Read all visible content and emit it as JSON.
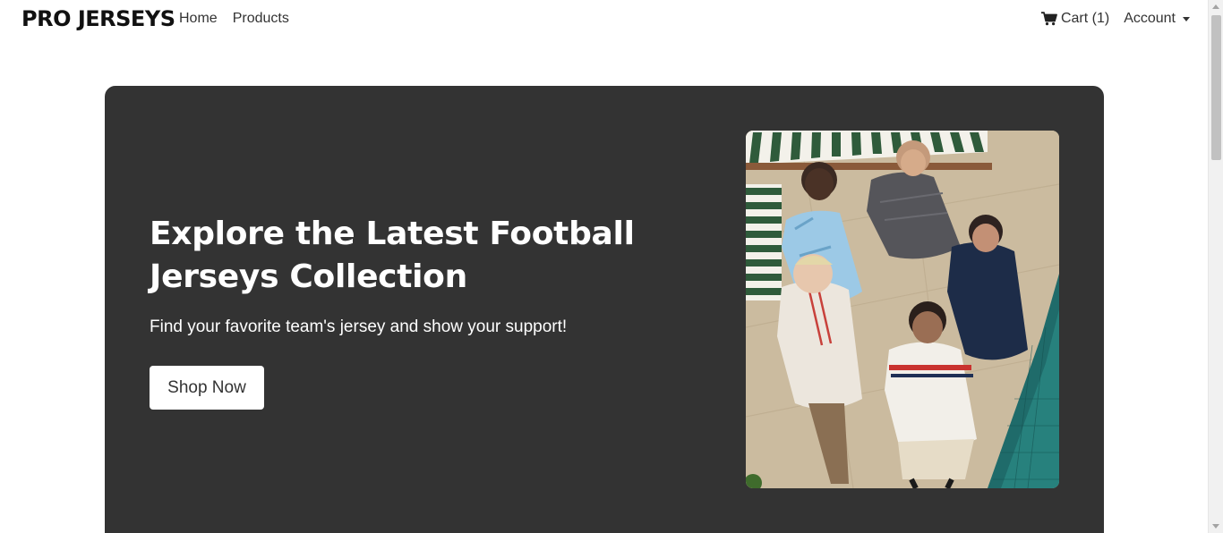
{
  "nav": {
    "brand": "PRO JERSEYS",
    "links": [
      "Home",
      "Products"
    ],
    "cart_label": "Cart (1)",
    "account_label": "Account"
  },
  "icons": {
    "cart": "shopping-cart-icon",
    "account_caret": "chevron-down-icon"
  },
  "hero": {
    "title": "Explore the Latest Football Jerseys Collection",
    "subtitle": "Find your favorite team's jersey and show your support!",
    "button_label": "Shop Now",
    "image_subject": "five players in football jerseys, viewed from above, poolside"
  },
  "colors": {
    "hero_bg": "#333333",
    "button_bg": "#ffffff",
    "text_light": "#ffffff",
    "nav_text": "#333333"
  }
}
